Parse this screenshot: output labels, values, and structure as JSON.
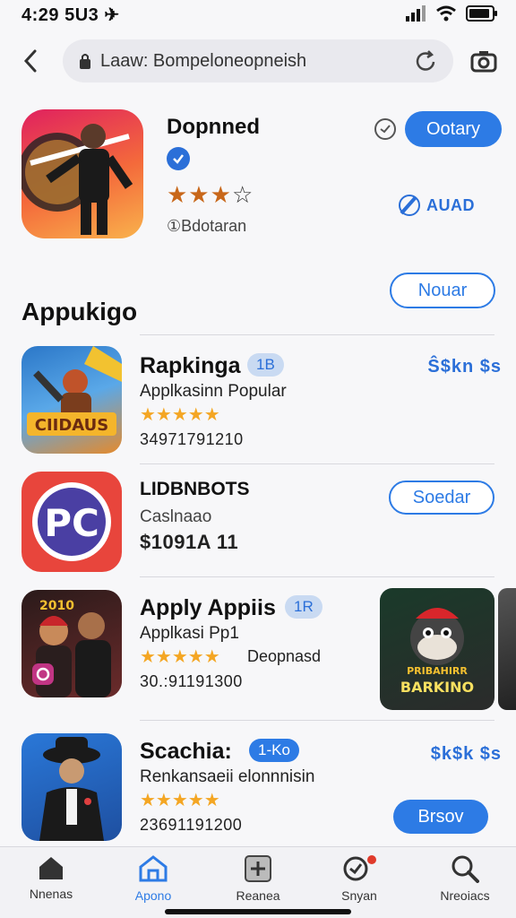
{
  "status": {
    "time": "4:29 5U3 ✈",
    "time_text": "4:29 5U3"
  },
  "nav": {
    "url": "Laaw: Bompeloneopneish"
  },
  "featured": {
    "title": "Dopnned",
    "rating_stars": "★★★☆",
    "count": "①Bdotaran",
    "get_label": "Ootary",
    "brand": "AUAD",
    "secondary_label": "Nouar"
  },
  "section": {
    "title": "Appukigo"
  },
  "apps": [
    {
      "name": "Rapkinga",
      "badge": "1B",
      "sub": "Applkasinn Popular",
      "stars": "★★★★★",
      "num": "34971791210",
      "price": "Ŝ$kn $s"
    },
    {
      "name": "LIDBNBOTS",
      "badge": "",
      "sub": "Caslnaao",
      "stars": "",
      "num": "$1091A 11",
      "price": "",
      "button": "Soedar"
    },
    {
      "name": "Apply Appiis",
      "badge": "1R",
      "sub": "Applkasi Pp1",
      "stars": "★★★★★",
      "num": "30.:91191300",
      "extra": "Deopnasd",
      "banner": "BARKINO",
      "banner_top": "PRIBAHIRR"
    },
    {
      "name": "Scachia:",
      "badge": "1-Ko",
      "sub": "Renkansaeii elonnnisin",
      "stars": "★★★★★",
      "num": "23691191200",
      "price": "$k$k $s",
      "button": "Brsov"
    }
  ],
  "tabs": [
    {
      "label": "Nnenas",
      "icon": "home-icon"
    },
    {
      "label": "Apono",
      "icon": "store-icon"
    },
    {
      "label": "Reanea",
      "icon": "plus-icon"
    },
    {
      "label": "Snyan",
      "icon": "search-badge-icon"
    },
    {
      "label": "Nreoiacs",
      "icon": "search-icon"
    }
  ],
  "colors": {
    "accent": "#2d7be5",
    "star": "#f4a623",
    "background": "#f7f7f9"
  }
}
